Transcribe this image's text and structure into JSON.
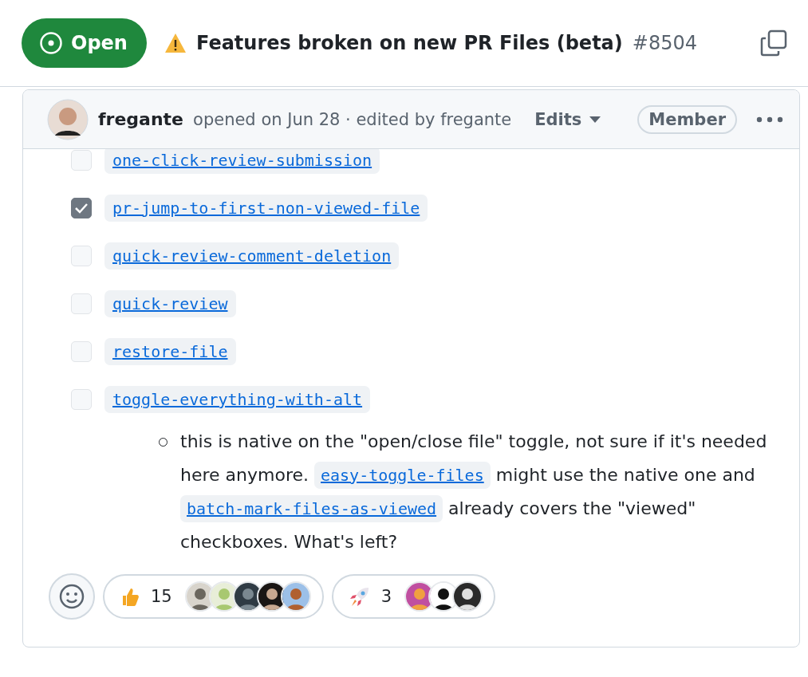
{
  "header": {
    "state": "Open",
    "title": "Features broken on new PR Files (beta)",
    "number": "#8504"
  },
  "comment": {
    "author": "fregante",
    "meta": "opened on Jun 28 · edited by fregante",
    "edits": "Edits",
    "role": "Member",
    "tasks": [
      {
        "label": "one-click-review-submission",
        "checked": false
      },
      {
        "label": "pr-jump-to-first-non-viewed-file",
        "checked": true
      },
      {
        "label": "quick-review-comment-deletion",
        "checked": false
      },
      {
        "label": "quick-review",
        "checked": false
      },
      {
        "label": "restore-file",
        "checked": false
      },
      {
        "label": "toggle-everything-with-alt",
        "checked": false
      }
    ],
    "note": [
      {
        "kind": "text",
        "text": "this is native on the \"open/close file\" toggle, not sure if it's needed here anymore. "
      },
      {
        "kind": "code",
        "text": "easy-toggle-files"
      },
      {
        "kind": "text",
        "text": " might use the native one and "
      },
      {
        "kind": "code",
        "text": "batch-mark-files-as-viewed"
      },
      {
        "kind": "text",
        "text": " already covers the \"viewed\" checkboxes. What's left?"
      }
    ],
    "reactions": [
      {
        "kind": "thumbs-up",
        "count": "15"
      },
      {
        "kind": "rocket",
        "count": "3"
      }
    ]
  }
}
